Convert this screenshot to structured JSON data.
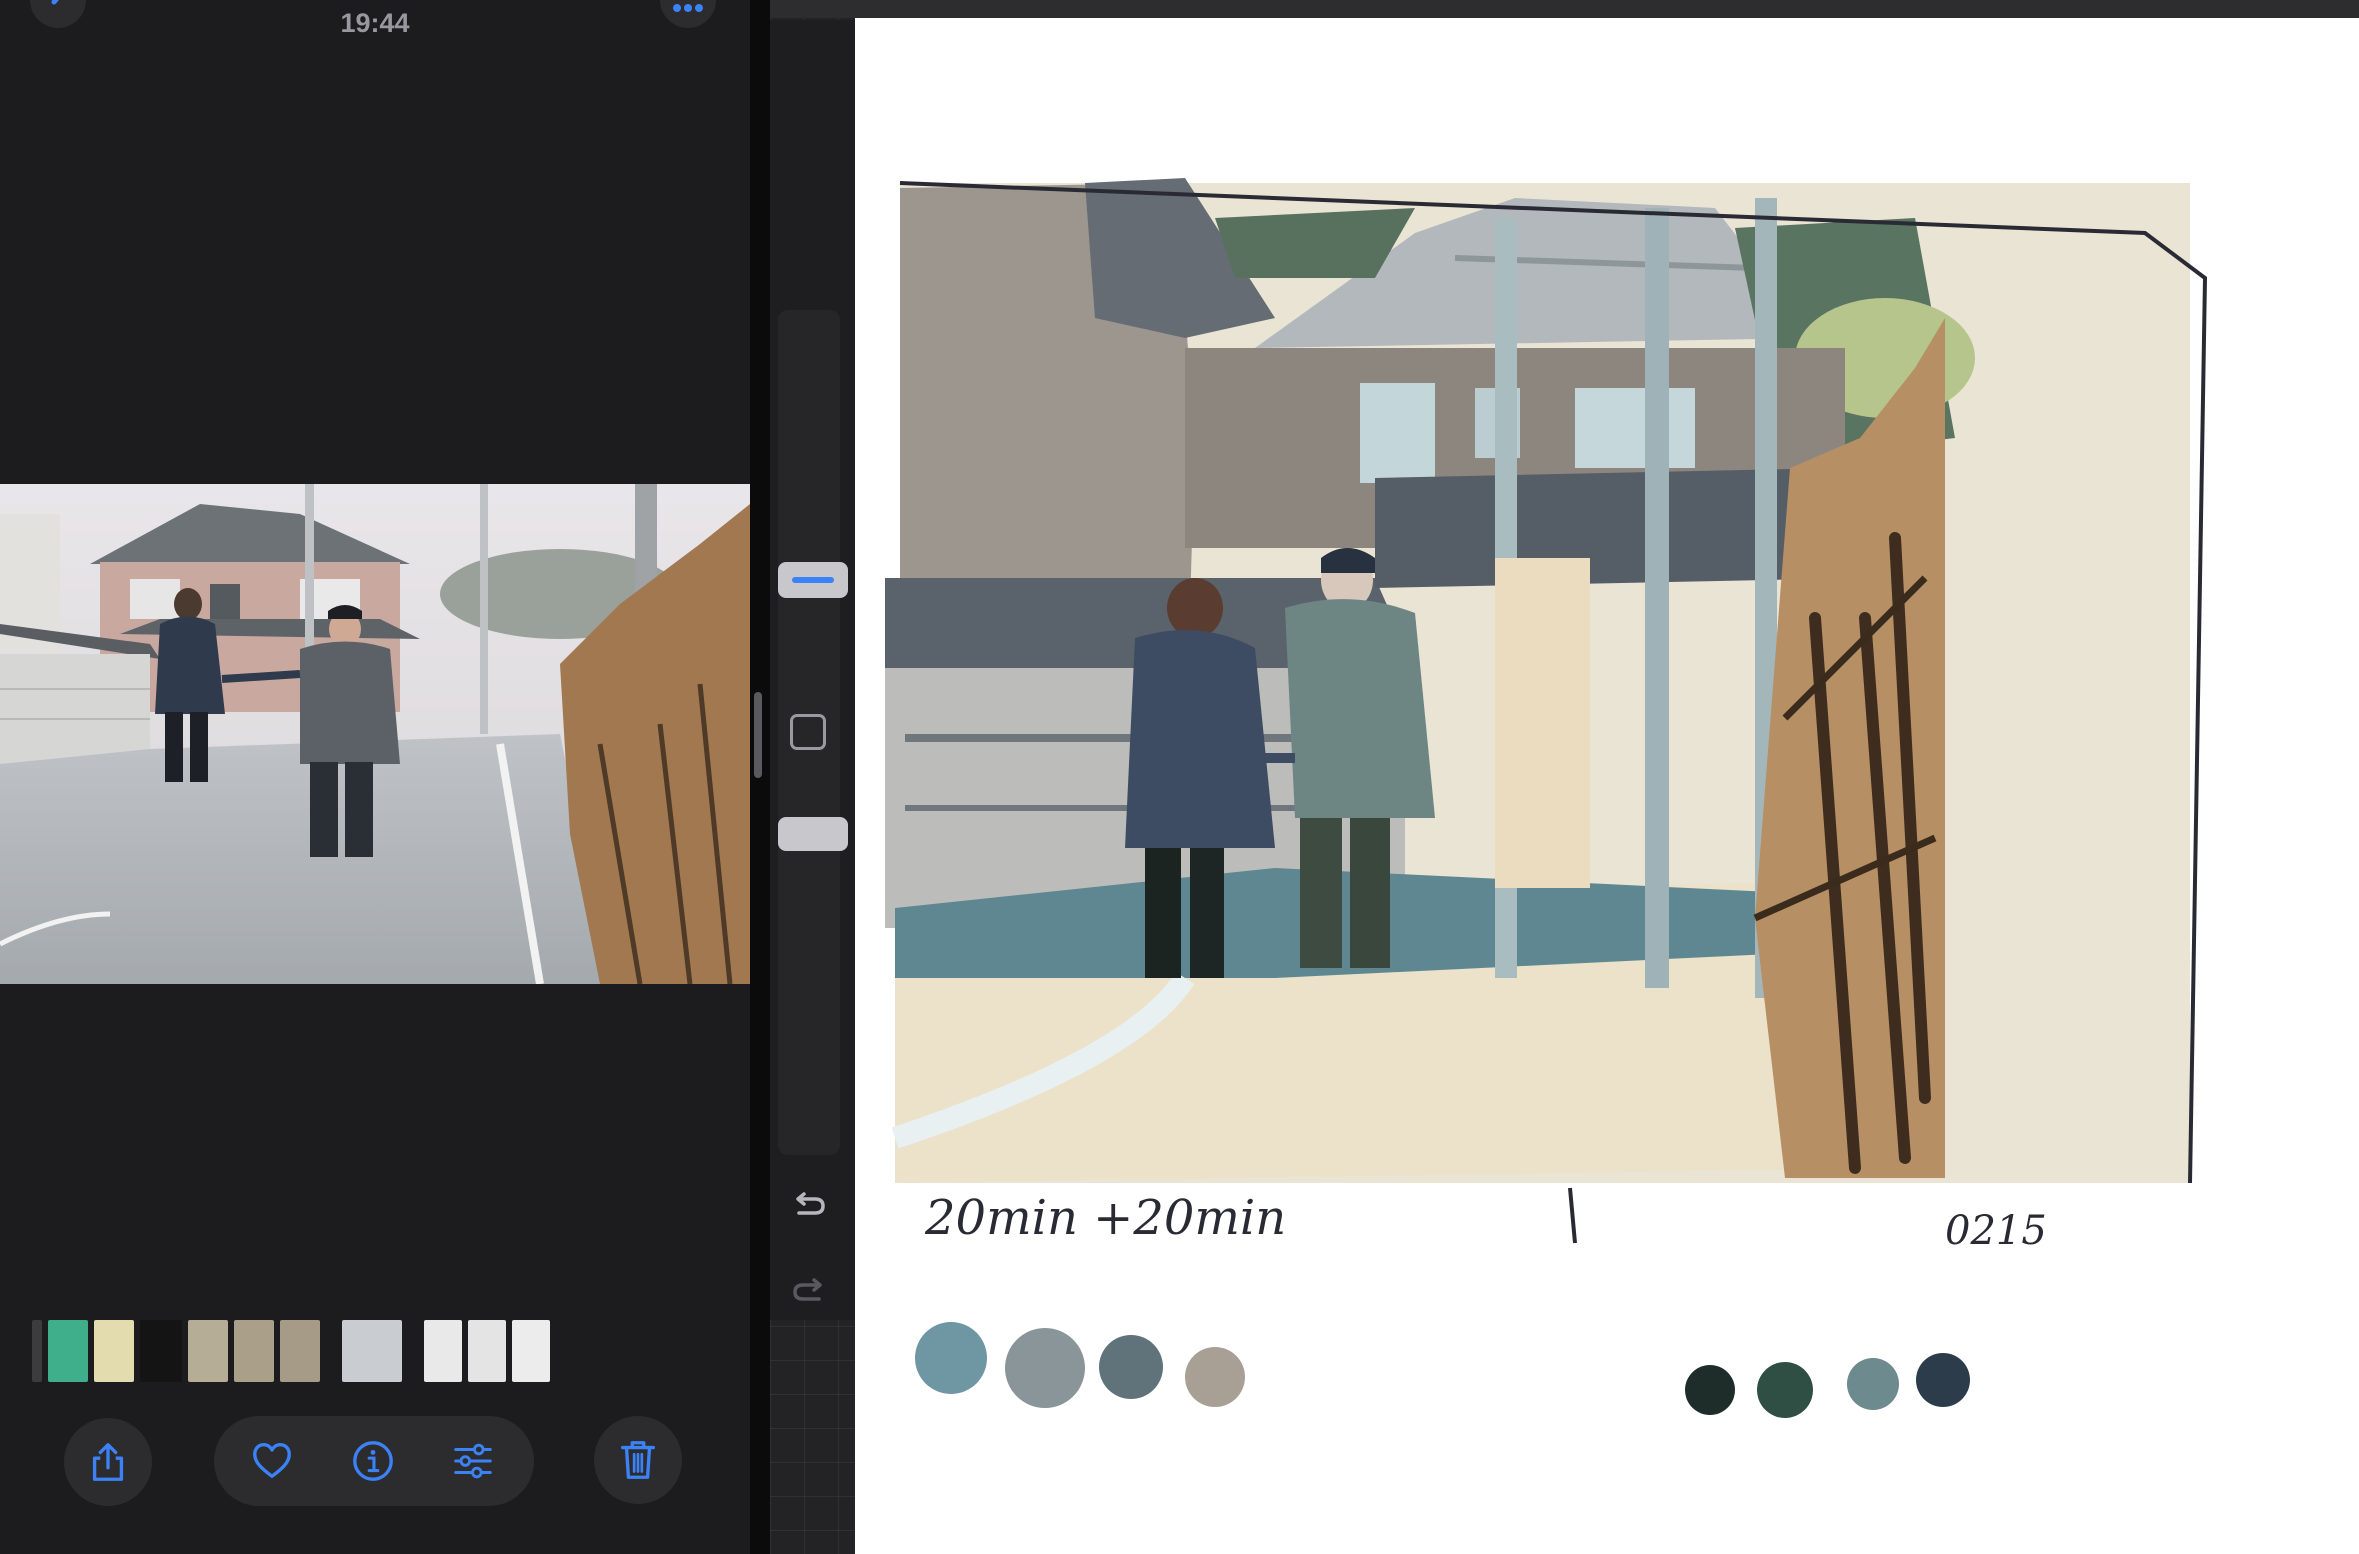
{
  "photos": {
    "time": "19:44",
    "thumbnails": [
      {
        "color": "#3c3c3e",
        "width": 10
      },
      {
        "color": "#3fae8a",
        "width": 40
      },
      {
        "color": "#e3dcae",
        "width": 40
      },
      {
        "color": "#141414",
        "width": 42
      },
      {
        "color": "#b6ad97",
        "width": 40
      },
      {
        "color": "#aaa08a",
        "width": 40
      },
      {
        "color": "#a69b86",
        "width": 40
      },
      {
        "color": "#c9cdd2",
        "width": 60
      },
      {
        "color": "#e9e9e9",
        "width": 38
      },
      {
        "color": "#e4e4e4",
        "width": 38
      },
      {
        "color": "#ececec",
        "width": 38
      }
    ],
    "toolbar": {
      "share": "share-icon",
      "favorite": "heart-icon",
      "info": "info-icon",
      "adjust": "sliders-icon",
      "delete": "trash-icon",
      "accent": "#3b82f6"
    }
  },
  "procreate": {
    "handwriting": {
      "timing": "20min +20min",
      "date": "0215"
    },
    "palette_left": [
      "#6e96a3",
      "#8a9599",
      "#60737a",
      "#a8a095"
    ],
    "palette_right": [
      "#1f2d2a",
      "#2f4f44",
      "#6d8a8f",
      "#2d3c4a"
    ]
  }
}
